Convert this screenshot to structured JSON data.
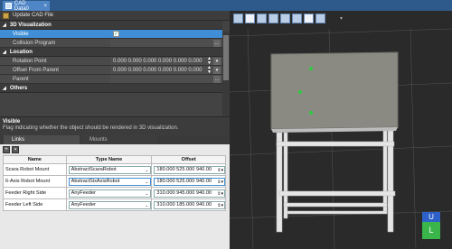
{
  "tab": {
    "title": "CAD Data0",
    "close": "×"
  },
  "toolbar": {
    "update_label": "Update CAD File"
  },
  "sections": {
    "visualization": "3D Visualization",
    "location": "Location",
    "others": "Others"
  },
  "properties": {
    "visible_label": "Visible",
    "visible_checked": "✓",
    "collision_label": "Collision Program",
    "rotation_label": "Rotation Point",
    "rotation_value": "0.000 0.000 0.000 0.000 0.000 0.000",
    "offset_label": "Offset From Parent",
    "offset_value": "0.000 0.000 0.000 0.000 0.000 0.000",
    "parent_label": "Parent"
  },
  "description": {
    "title": "Visible",
    "text": "Flag indicating whether the object should be rendered in 3D visualization."
  },
  "bottom_tabs": {
    "links": "Links",
    "mounts": "Mounts"
  },
  "links_table": {
    "headers": {
      "name": "Name",
      "type": "Type Name",
      "offset": "Offset"
    },
    "rows": [
      {
        "name": "Scara Robot Mount",
        "type": "AbstractScaraRobot",
        "offset": "180.000 525.000 940.00"
      },
      {
        "name": "6-Axis Robot Mount",
        "type": "AbstractSixAxisRobot",
        "offset": "180.000 525.000 940.00"
      },
      {
        "name": "Feeder Right Side",
        "type": "AnyFeeder",
        "offset": "310.000 945.000 940.00"
      },
      {
        "name": "Feeder Left Side",
        "type": "AnyFeeder",
        "offset": "310.000 185.000 940.00"
      }
    ]
  },
  "viewcube": {
    "top": "U",
    "front": "L"
  },
  "colors": {
    "accent": "#3f8ed6",
    "viewcube_top": "#2d61c9",
    "viewcube_front": "#39b54a",
    "marker": "#2ecc40"
  }
}
